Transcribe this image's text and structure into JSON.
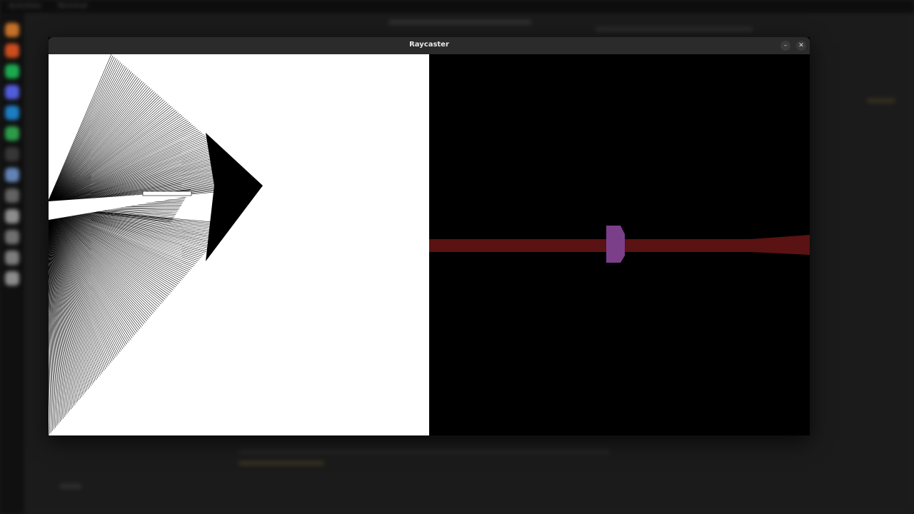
{
  "window": {
    "title": "Raycaster",
    "minimize_symbol": "–",
    "close_symbol": "✕"
  },
  "desktop": {
    "topbar_left": "Activities",
    "topbar_app": "Terminal"
  },
  "dock": {
    "icons": [
      {
        "name": "browser-icon",
        "color": "#d97a2a"
      },
      {
        "name": "firefox-icon",
        "color": "#e0531f"
      },
      {
        "name": "spotify-icon",
        "color": "#1db954"
      },
      {
        "name": "discord-icon",
        "color": "#5865f2"
      },
      {
        "name": "vscode-icon",
        "color": "#1e88d6"
      },
      {
        "name": "chat-icon",
        "color": "#2eaa4e"
      },
      {
        "name": "terminal-icon",
        "color": "#3a3a3a"
      },
      {
        "name": "files-icon",
        "color": "#6b8fc7"
      },
      {
        "name": "settings-icon",
        "color": "#6a6a6a"
      },
      {
        "name": "trash-icon",
        "color": "#9a9a9a"
      },
      {
        "name": "disk-icon",
        "color": "#7a7a7a"
      },
      {
        "name": "app-icon",
        "color": "#888888"
      },
      {
        "name": "app2-icon",
        "color": "#999999"
      }
    ]
  },
  "colors": {
    "map_background": "#ffffff",
    "ray_color": "#000000",
    "scene_background": "#000000",
    "wall_color": "#5a1212",
    "sprite_color": "#7b3f8a"
  }
}
